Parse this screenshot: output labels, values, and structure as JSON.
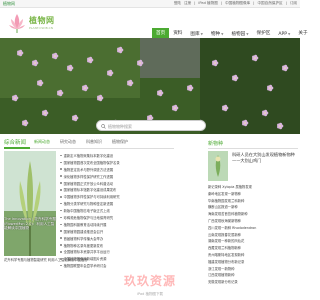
{
  "topbar": {
    "brand": "植物网",
    "links": [
      "登陆",
      "注册",
      "|",
      "iPad 植物图",
      "|",
      "中国植物图像库",
      "|",
      "中国自然保护区",
      "|",
      "订阅"
    ]
  },
  "header": {
    "logo_text": "植物网",
    "logo_sub": "PLANT.CSDB.CN"
  },
  "nav": [
    {
      "label": "首页",
      "active": true,
      "caret": false
    },
    {
      "label": "资料",
      "active": false,
      "caret": false
    },
    {
      "label": "图库",
      "active": false,
      "caret": true
    },
    {
      "label": "物种",
      "active": false,
      "caret": true
    },
    {
      "label": "植物园",
      "active": false,
      "caret": true
    },
    {
      "label": "保护区",
      "active": false,
      "caret": false
    },
    {
      "label": "APP",
      "active": false,
      "caret": true
    },
    {
      "label": "关于",
      "active": false,
      "caret": false
    }
  ],
  "search": {
    "placeholder": "植物物种搜索"
  },
  "left": {
    "section_title": "综合新闻",
    "tabs": [
      {
        "label": "新闻动态",
        "active": true
      },
      {
        "label": "研究动态",
        "active": false
      },
      {
        "label": "科普知识",
        "active": false
      },
      {
        "label": "植物保护",
        "active": false
      }
    ],
    "overlay_title": "The Innovation | 花卉科学专题(FlowerMsn 2.0)：利用人工智能解读中国植物",
    "caption": "花卉科学专题与植物智能研究 利用人工智能解读中国植物",
    "news": [
      "重新定义植物采集标本数字化建设",
      "国家植物园首次发布全国植物保护名录",
      "植物鉴定技术与野外调查方法进展",
      "深化植物多样性保护研究工作进展",
      "国家植物园正式开放公众科普活动",
      "国家植物标本馆数字化建设成果发布",
      "中国植物多样性保护与可持续利用研究",
      "植物分类学研究与物种鉴定新进展",
      "新版中国植物志电子版正式上线",
      "珍稀濒危植物保护与迁地保育研究",
      "植物园科普教育活动持续开展",
      "国家植物园建设推进会召开",
      "首届植物科学传播大会举办",
      "植物物种名录年度更新发布",
      "全国植物标本资源共享平台运行",
      "中国植物图像库新增图片资源",
      "植物园联盟年会暨学术研讨会"
    ]
  },
  "right": {
    "title": "新物种",
    "headline": "科研人员在大别山发现植物新物种——大别山鸡门",
    "list": [
      "新记录种 Xylopia 属植物发现",
      "秦岭地区发现一新物种",
      "华南植物园发现兰科新种",
      "横断山区报道一新种",
      "海南发现苦苣苔科植物新种",
      "广西发现秋海棠新物种",
      "四川发现一新种 Rhododendron",
      "云南发现报春花属新种",
      "湖南发现一种新的凤仙花",
      "西藏发现兰科植物新种",
      "贵州喀斯特地区发现新种",
      "福建发现植物分布新记录",
      "浙江发现一新物种",
      "江西发现植物新种",
      "安徽发现新分布记录"
    ]
  },
  "watermark": {
    "cn": "玖玖资源",
    "en": "iPad 植物图下载"
  }
}
